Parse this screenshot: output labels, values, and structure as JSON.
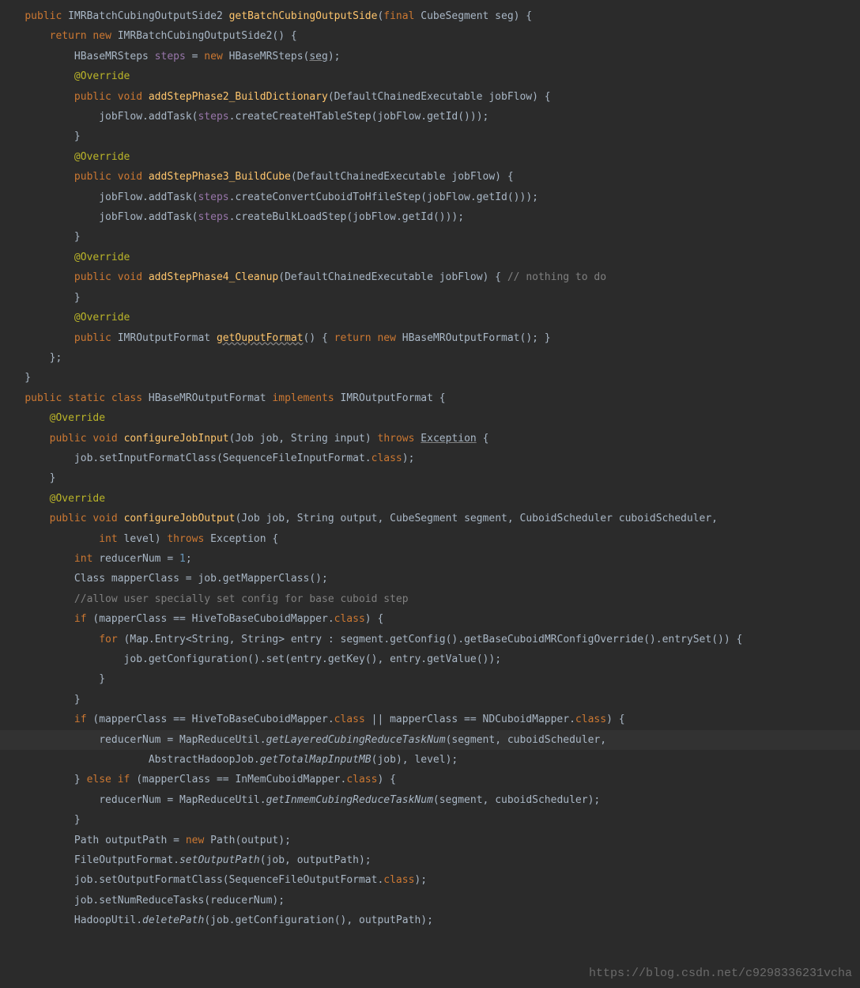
{
  "watermark": "https://blog.csdn.net/c9298336231vcha",
  "code": {
    "l1": {
      "kw_public": "public",
      "type1": "IMRBatchCubingOutputSide2",
      "meth": "getBatchCubingOutputSide",
      "kw_final": "final",
      "type2": "CubeSegment",
      "param": "seg"
    },
    "l2": {
      "kw_return": "return",
      "kw_new": "new",
      "type": "IMRBatchCubingOutputSide2"
    },
    "l3": {
      "type1": "HBaseMRSteps",
      "var": "steps",
      "kw_new": "new",
      "type2": "HBaseMRSteps",
      "arg": "seg"
    },
    "l4": {
      "ann": "@Override"
    },
    "l5": {
      "kw_public": "public",
      "kw_void": "void",
      "meth": "addStepPhase2_BuildDictionary",
      "ptype": "DefaultChainedExecutable",
      "p": "jobFlow"
    },
    "l6": {
      "o": "jobFlow",
      "m1": "addTask",
      "a1": "steps",
      "m2": "createCreateHTableStep",
      "a2": "jobFlow",
      "m3": "getId"
    },
    "l7": {
      "ann": "@Override"
    },
    "l8": {
      "kw_public": "public",
      "kw_void": "void",
      "meth": "addStepPhase3_BuildCube",
      "ptype": "DefaultChainedExecutable",
      "p": "jobFlow"
    },
    "l9": {
      "o": "jobFlow",
      "m1": "addTask",
      "a1": "steps",
      "m2": "createConvertCuboidToHfileStep",
      "a2": "jobFlow",
      "m3": "getId"
    },
    "l10": {
      "o": "jobFlow",
      "m1": "addTask",
      "a1": "steps",
      "m2": "createBulkLoadStep",
      "a2": "jobFlow",
      "m3": "getId"
    },
    "l11": {
      "ann": "@Override"
    },
    "l12": {
      "kw_public": "public",
      "kw_void": "void",
      "meth": "addStepPhase4_Cleanup",
      "ptype": "DefaultChainedExecutable",
      "p": "jobFlow",
      "cmt": "// nothing to do"
    },
    "l13": {
      "ann": "@Override"
    },
    "l14": {
      "kw_public": "public",
      "type": "IMROutputFormat",
      "meth": "getOuputFormat",
      "kw_return": "return",
      "kw_new": "new",
      "type2": "HBaseMROutputFormat"
    },
    "l15": {
      "kw_public": "public",
      "kw_static": "static",
      "kw_class": "class",
      "name": "HBaseMROutputFormat",
      "kw_impl": "implements",
      "iface": "IMROutputFormat"
    },
    "l16": {
      "ann": "@Override"
    },
    "l17": {
      "kw_public": "public",
      "kw_void": "void",
      "meth": "configureJobInput",
      "pt1": "Job",
      "p1": "job",
      "pt2": "String",
      "p2": "input",
      "kw_throws": "throws",
      "ex": "Exception"
    },
    "l18": {
      "o": "job",
      "m": "setInputFormatClass",
      "a": "SequenceFileInputFormat",
      "kw_class": "class"
    },
    "l19": {
      "ann": "@Override"
    },
    "l20": {
      "kw_public": "public",
      "kw_void": "void",
      "meth": "configureJobOutput",
      "pt1": "Job",
      "p1": "job",
      "pt2": "String",
      "p2": "output",
      "pt3": "CubeSegment",
      "p3": "segment",
      "pt4": "CuboidScheduler",
      "p4": "cuboidScheduler"
    },
    "l21": {
      "kw_int": "int",
      "p": "level",
      "kw_throws": "throws",
      "ex": "Exception"
    },
    "l22": {
      "kw_int": "int",
      "v": "reducerNum",
      "n": "1"
    },
    "l23": {
      "t": "Class",
      "v": "mapperClass",
      "o": "job",
      "m": "getMapperClass"
    },
    "l24": {
      "cmt": "//allow user specially set config for base cuboid step"
    },
    "l25": {
      "kw_if": "if",
      "v": "mapperClass",
      "t": "HiveToBaseCuboidMapper",
      "kw_class": "class"
    },
    "l26": {
      "kw_for": "for",
      "t1": "Map",
      "t2": "Entry",
      "g1": "String",
      "g2": "String",
      "v": "entry",
      "o": "segment",
      "m1": "getConfig",
      "m2": "getBaseCuboidMRConfigOverride",
      "m3": "entrySet"
    },
    "l27": {
      "o": "job",
      "m1": "getConfiguration",
      "m2": "set",
      "a1": "entry",
      "m3": "getKey",
      "a2": "entry",
      "m4": "getValue"
    },
    "l28": {
      "kw_if": "if",
      "v": "mapperClass",
      "t1": "HiveToBaseCuboidMapper",
      "kw_class": "class",
      "t2": "NDCuboidMapper"
    },
    "l29": {
      "v": "reducerNum",
      "t": "MapReduceUtil",
      "m": "getLayeredCubingReduceTaskNum",
      "a1": "segment",
      "a2": "cuboidScheduler"
    },
    "l30": {
      "t": "AbstractHadoopJob",
      "m": "getTotalMapInputMB",
      "a1": "job",
      "a2": "level"
    },
    "l31": {
      "kw_else": "else",
      "kw_if": "if",
      "v": "mapperClass",
      "t": "InMemCuboidMapper",
      "kw_class": "class"
    },
    "l32": {
      "v": "reducerNum",
      "t": "MapReduceUtil",
      "m": "getInmemCubingReduceTaskNum",
      "a1": "segment",
      "a2": "cuboidScheduler"
    },
    "l33": {
      "t": "Path",
      "v": "outputPath",
      "kw_new": "new",
      "t2": "Path",
      "a": "output"
    },
    "l34": {
      "t": "FileOutputFormat",
      "m": "setOutputPath",
      "a1": "job",
      "a2": "outputPath"
    },
    "l35": {
      "o": "job",
      "m": "setOutputFormatClass",
      "a": "SequenceFileOutputFormat",
      "kw_class": "class"
    },
    "l36": {
      "o": "job",
      "m": "setNumReduceTasks",
      "a": "reducerNum"
    },
    "l37": {
      "t": "HadoopUtil",
      "m": "deletePath",
      "o": "job",
      "m2": "getConfiguration",
      "a": "outputPath"
    }
  }
}
